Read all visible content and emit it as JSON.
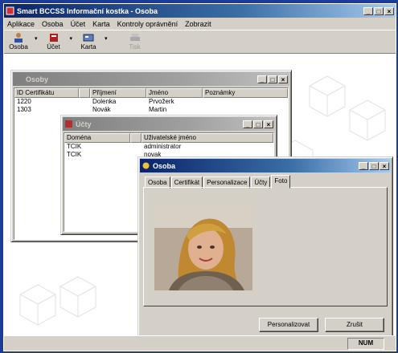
{
  "app": {
    "title": "Smart BCCSS Informační kostka - Osoba",
    "window_buttons": {
      "minimize": "_",
      "maximize": "□",
      "close": "×"
    }
  },
  "menu": [
    "Aplikace",
    "Osoba",
    "Účet",
    "Karta",
    "Kontroly oprávnění",
    "Zobrazit"
  ],
  "toolbar": [
    {
      "label": "Osoba",
      "icon": "person-icon",
      "enabled": true
    },
    {
      "label": "Účet",
      "icon": "account-icon",
      "enabled": true
    },
    {
      "label": "Karta",
      "icon": "card-icon",
      "enabled": true
    },
    {
      "label": "Tisk",
      "icon": "printer-icon",
      "enabled": false
    }
  ],
  "win_osoby": {
    "title": "Osoby",
    "columns": [
      "ID Certifikátu",
      "",
      "Příjmení",
      "Jméno",
      "Poznámky"
    ],
    "rows": [
      [
        "1220",
        "",
        "Dolenka",
        "Prvožerk",
        ""
      ],
      [
        "1303",
        "",
        "Novák",
        "Martin",
        ""
      ]
    ]
  },
  "win_ucty": {
    "title": "Účty",
    "columns": [
      "Doména",
      "",
      "Uživatelské jméno"
    ],
    "rows": [
      [
        "TCIK",
        "",
        "administrator"
      ],
      [
        "TCIK",
        "",
        "novak"
      ]
    ]
  },
  "win_detail": {
    "title": "Osoba",
    "tabs": [
      "Osoba",
      "Certifikát",
      "Personalizace",
      "Účty",
      "Foto"
    ],
    "active_tab": "Foto",
    "buttons": {
      "left": "Personalizovat",
      "right": "Zrušit"
    }
  },
  "status": {
    "text": "NUM"
  }
}
